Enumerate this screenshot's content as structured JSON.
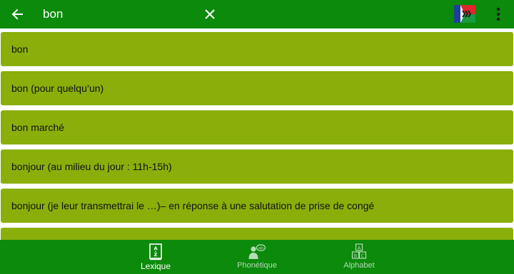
{
  "colors": {
    "topbar": "#0b8a0b",
    "item_bg": "#8aaf0b",
    "bottomnav": "#0b8a0b",
    "active_label": "#ffffff",
    "inactive_label": "#b6d9b6"
  },
  "header": {
    "back_icon": "arrow-left-icon",
    "search_value": "bon",
    "clear_icon": "close-icon",
    "flag_icon": "france-to-malagasy-flag-icon",
    "menu_icon": "more-vertical-icon"
  },
  "results": [
    {
      "text": "bon"
    },
    {
      "text": "bon (pour quelqu’un)"
    },
    {
      "text": "bon marché"
    },
    {
      "text": "bonjour (au milieu du jour : 11h-15h)"
    },
    {
      "text": "bonjour (je leur transmettrai le …)– en réponse à une salutation de prise de congé"
    },
    {
      "text": ""
    }
  ],
  "bottom_nav": {
    "tabs": [
      {
        "label": "Lexique",
        "icon": "dictionary-icon",
        "active": true
      },
      {
        "label": "Phonétique",
        "icon": "speaking-person-icon",
        "active": false
      },
      {
        "label": "Alphabet",
        "icon": "alphabet-blocks-icon",
        "active": false
      }
    ]
  }
}
